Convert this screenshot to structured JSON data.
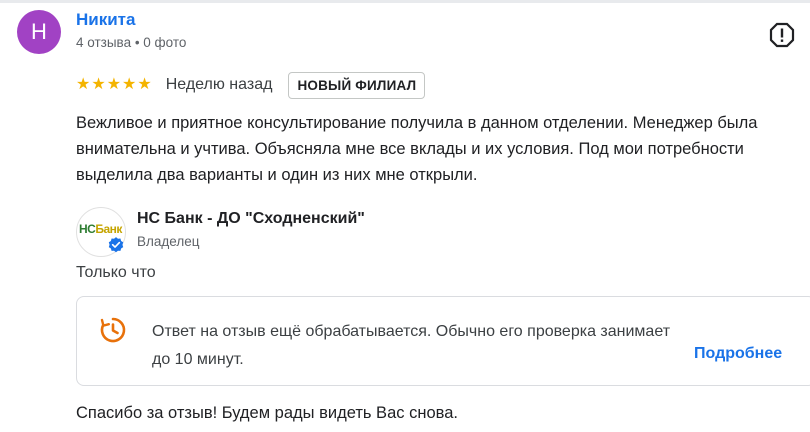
{
  "review": {
    "author": {
      "initial": "Н",
      "name": "Никита",
      "meta": "4 отзыва • 0 фото",
      "avatar_color": "#a142c4"
    },
    "rating": 5,
    "when": "Неделю назад",
    "badge": "НОВЫЙ ФИЛИАЛ",
    "text": "Вежливое и приятное консультирование получила в данном отделении. Менеджер была внимательна и учтива. Объясняла мне все вклады и их условия. Под мои потребности выделила два варианты и один из них мне открыли.",
    "report_icon": "report-flag-icon"
  },
  "owner_reply": {
    "logo_text_green": "НС",
    "logo_text_yellow": "Банк",
    "name": "НС Банк - ДО \"Сходненский\"",
    "role": "Владелец",
    "time": "Только что",
    "notice": {
      "icon": "clock-pending-icon",
      "text": "Ответ на отзыв ещё обрабатывается. Обычно его проверка занимает до 10 минут.",
      "link": "Подробнее"
    },
    "text": "Спасибо за отзыв! Будем рады видеть Вас снова."
  },
  "colors": {
    "accent": "#1a73e8",
    "star": "#f4b400",
    "notice_icon": "#e8710a"
  }
}
